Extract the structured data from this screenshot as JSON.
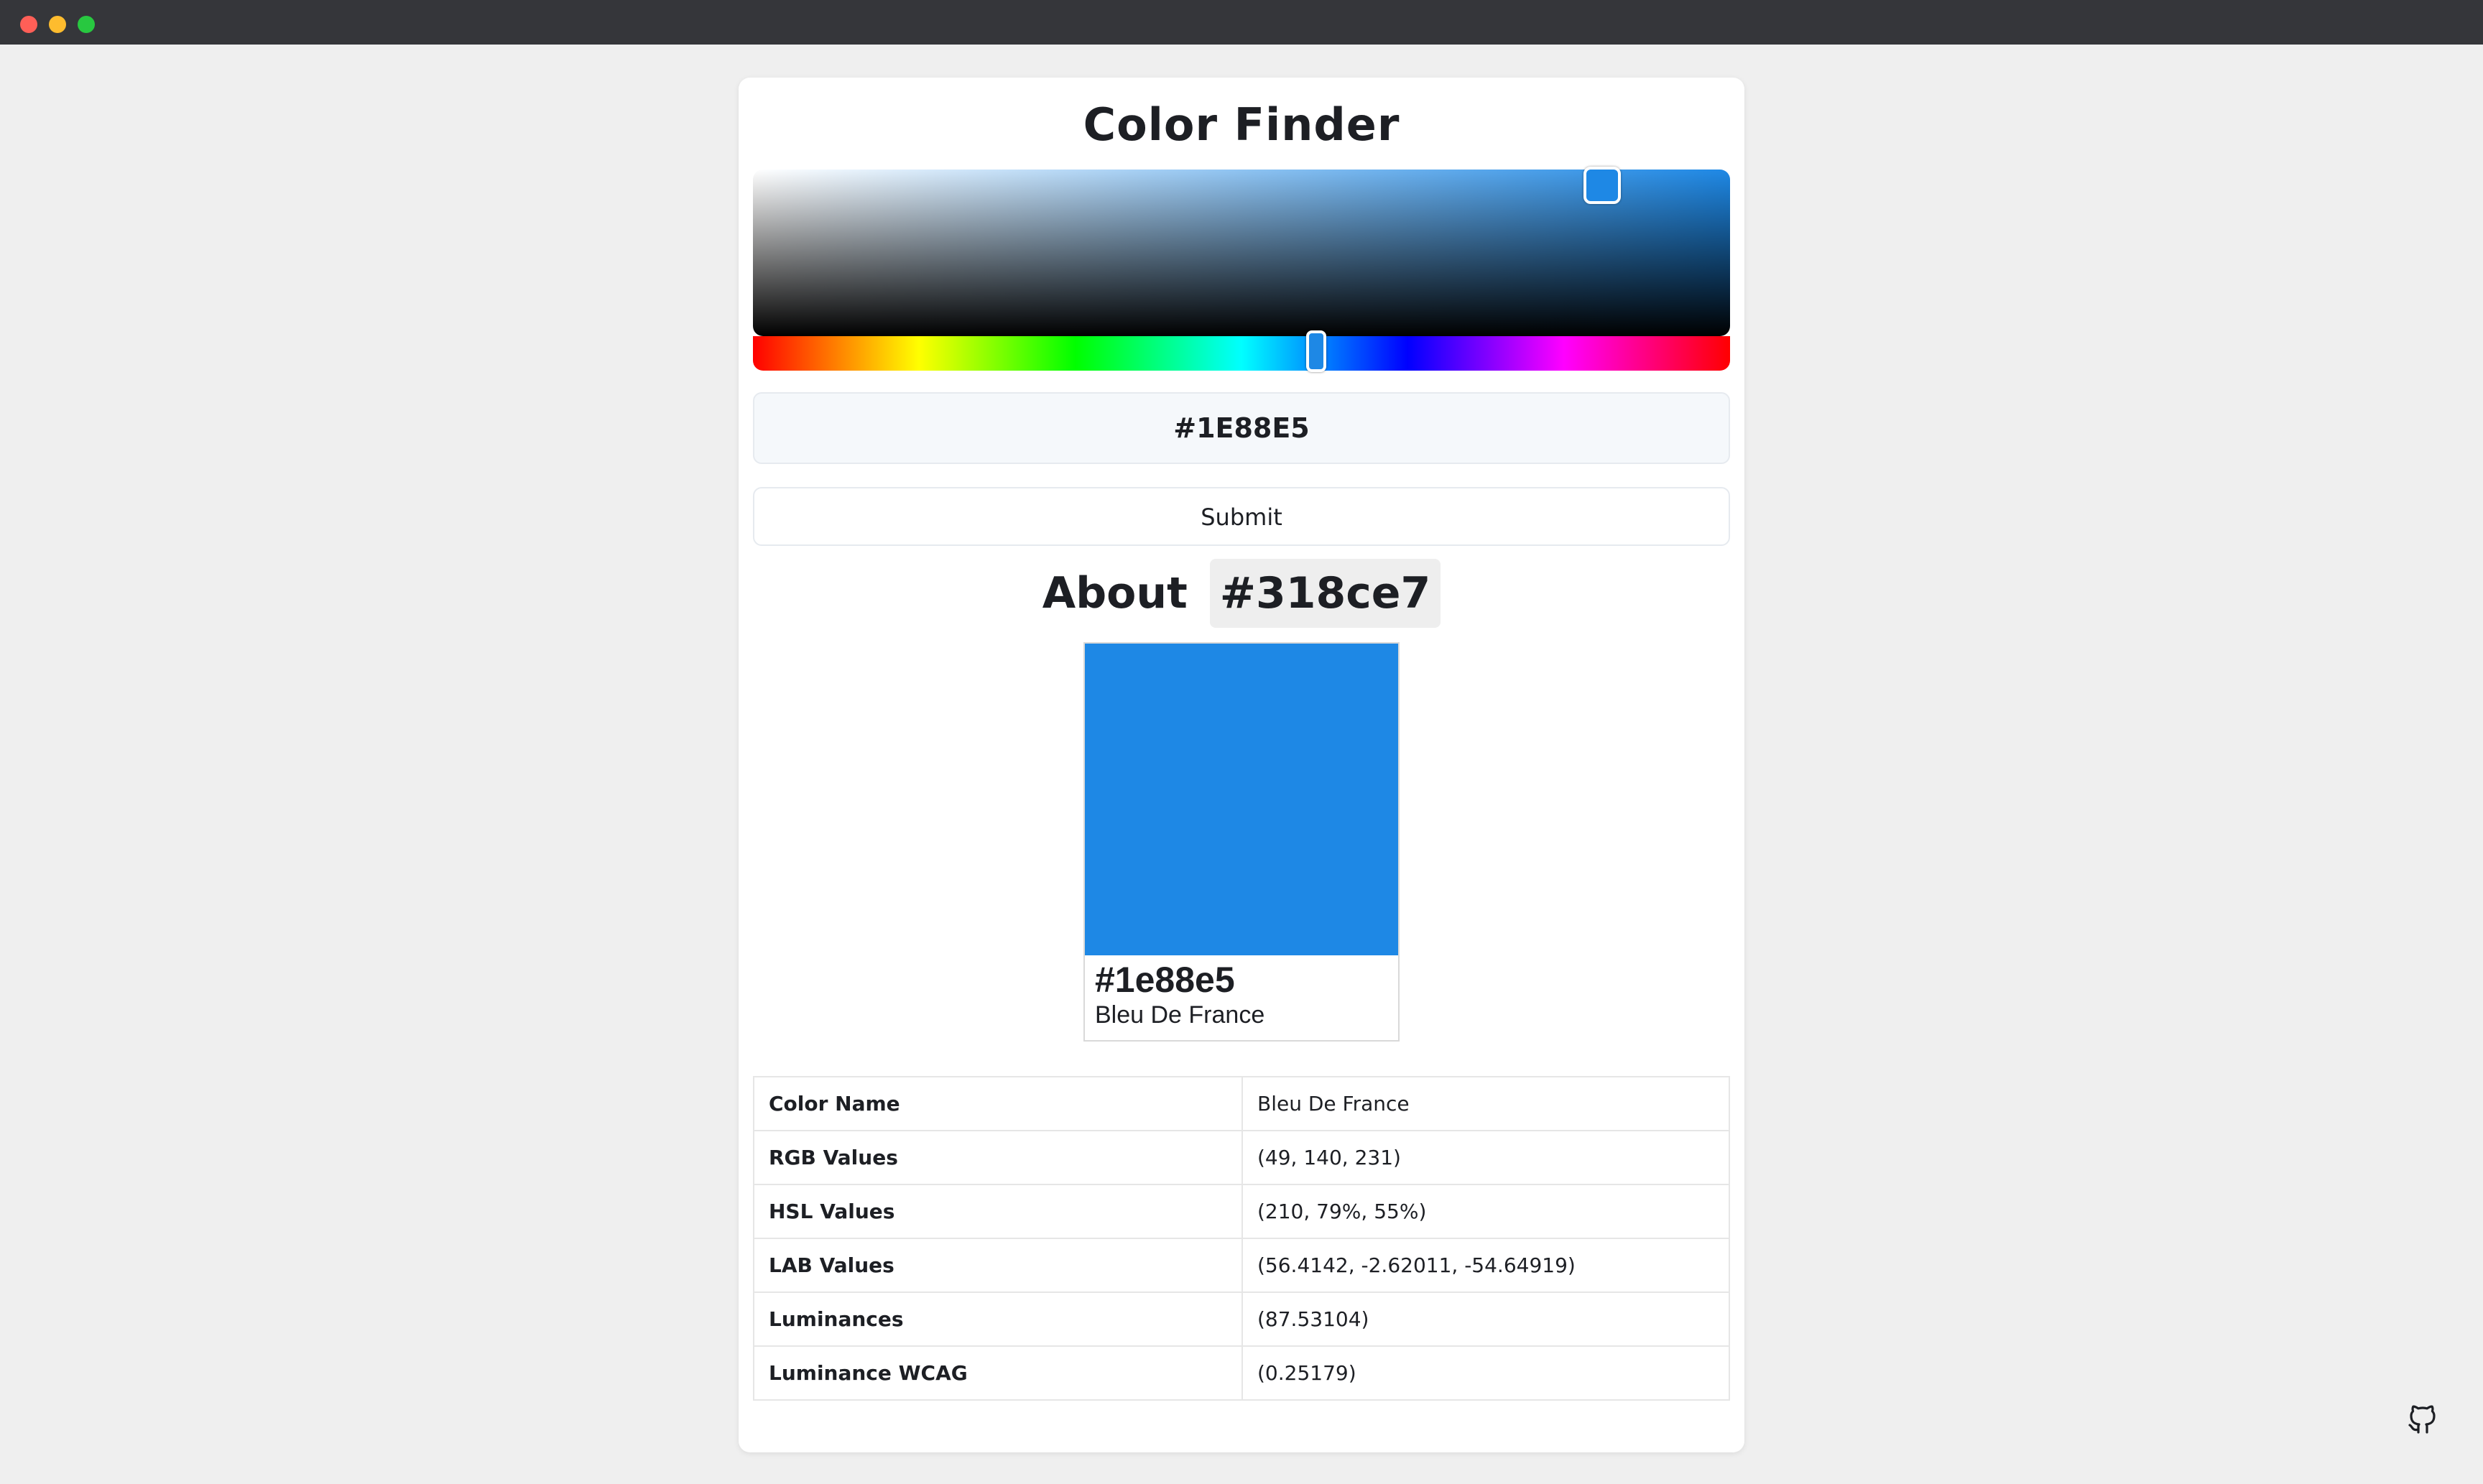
{
  "window": {
    "traffic_lights": [
      "close",
      "minimize",
      "zoom"
    ]
  },
  "app": {
    "title": "Color Finder"
  },
  "picker": {
    "hue_color": "#1e88e5",
    "selected_color": "#1e88e5"
  },
  "hex_input": {
    "value": "#1E88E5"
  },
  "submit": {
    "label": "Submit"
  },
  "about": {
    "prefix": "About",
    "code": "#318ce7"
  },
  "swatch": {
    "color": "#1e88e5",
    "hex": "#1e88e5",
    "name": "Bleu De France"
  },
  "info_table": {
    "rows": [
      {
        "key": "Color Name",
        "value": "Bleu De France"
      },
      {
        "key": "RGB Values",
        "value": "(49, 140, 231)"
      },
      {
        "key": "HSL Values",
        "value": "(210, 79%, 55%)"
      },
      {
        "key": "LAB Values",
        "value": "(56.4142, -2.62011, -54.64919)"
      },
      {
        "key": "Luminances",
        "value": "(87.53104)"
      },
      {
        "key": "Luminance WCAG",
        "value": "(0.25179)"
      }
    ]
  },
  "footer": {
    "icon": "github-icon"
  }
}
